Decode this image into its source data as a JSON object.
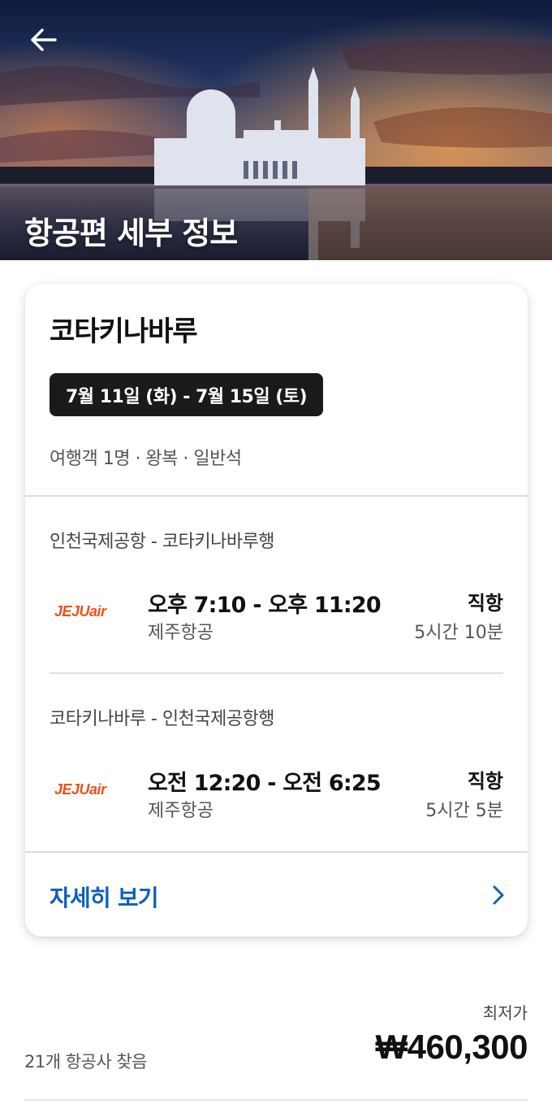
{
  "header": {
    "title": "항공편 세부 정보",
    "back_icon": "arrow-left-icon"
  },
  "card": {
    "destination": "코타키나바루",
    "dates": "7월 11일 (화) - 7월 15일 (토)",
    "trip_info": "여행객 1명 · 왕복 · 일반석",
    "legs": [
      {
        "route": "인천국제공항 - 코타키나바루행",
        "airline_logo": "JEJUair",
        "times": "오후 7:10 - 오후 11:20",
        "airline": "제주항공",
        "stops": "직항",
        "duration": "5시간 10분"
      },
      {
        "route": "코타키나바루 - 인천국제공항행",
        "airline_logo": "JEJUair",
        "times": "오전 12:20 - 오전 6:25",
        "airline": "제주항공",
        "stops": "직항",
        "duration": "5시간 5분"
      }
    ],
    "details_label": "자세히 보기",
    "details_icon": "chevron-right-icon"
  },
  "summary": {
    "lowest_label": "최저가",
    "airlines_found": "21개 항공사 찾음",
    "price": "₩460,300"
  },
  "colors": {
    "link": "#0d5fbf",
    "chip": "#1a1a1a",
    "airline_brand": "#e8531a"
  }
}
